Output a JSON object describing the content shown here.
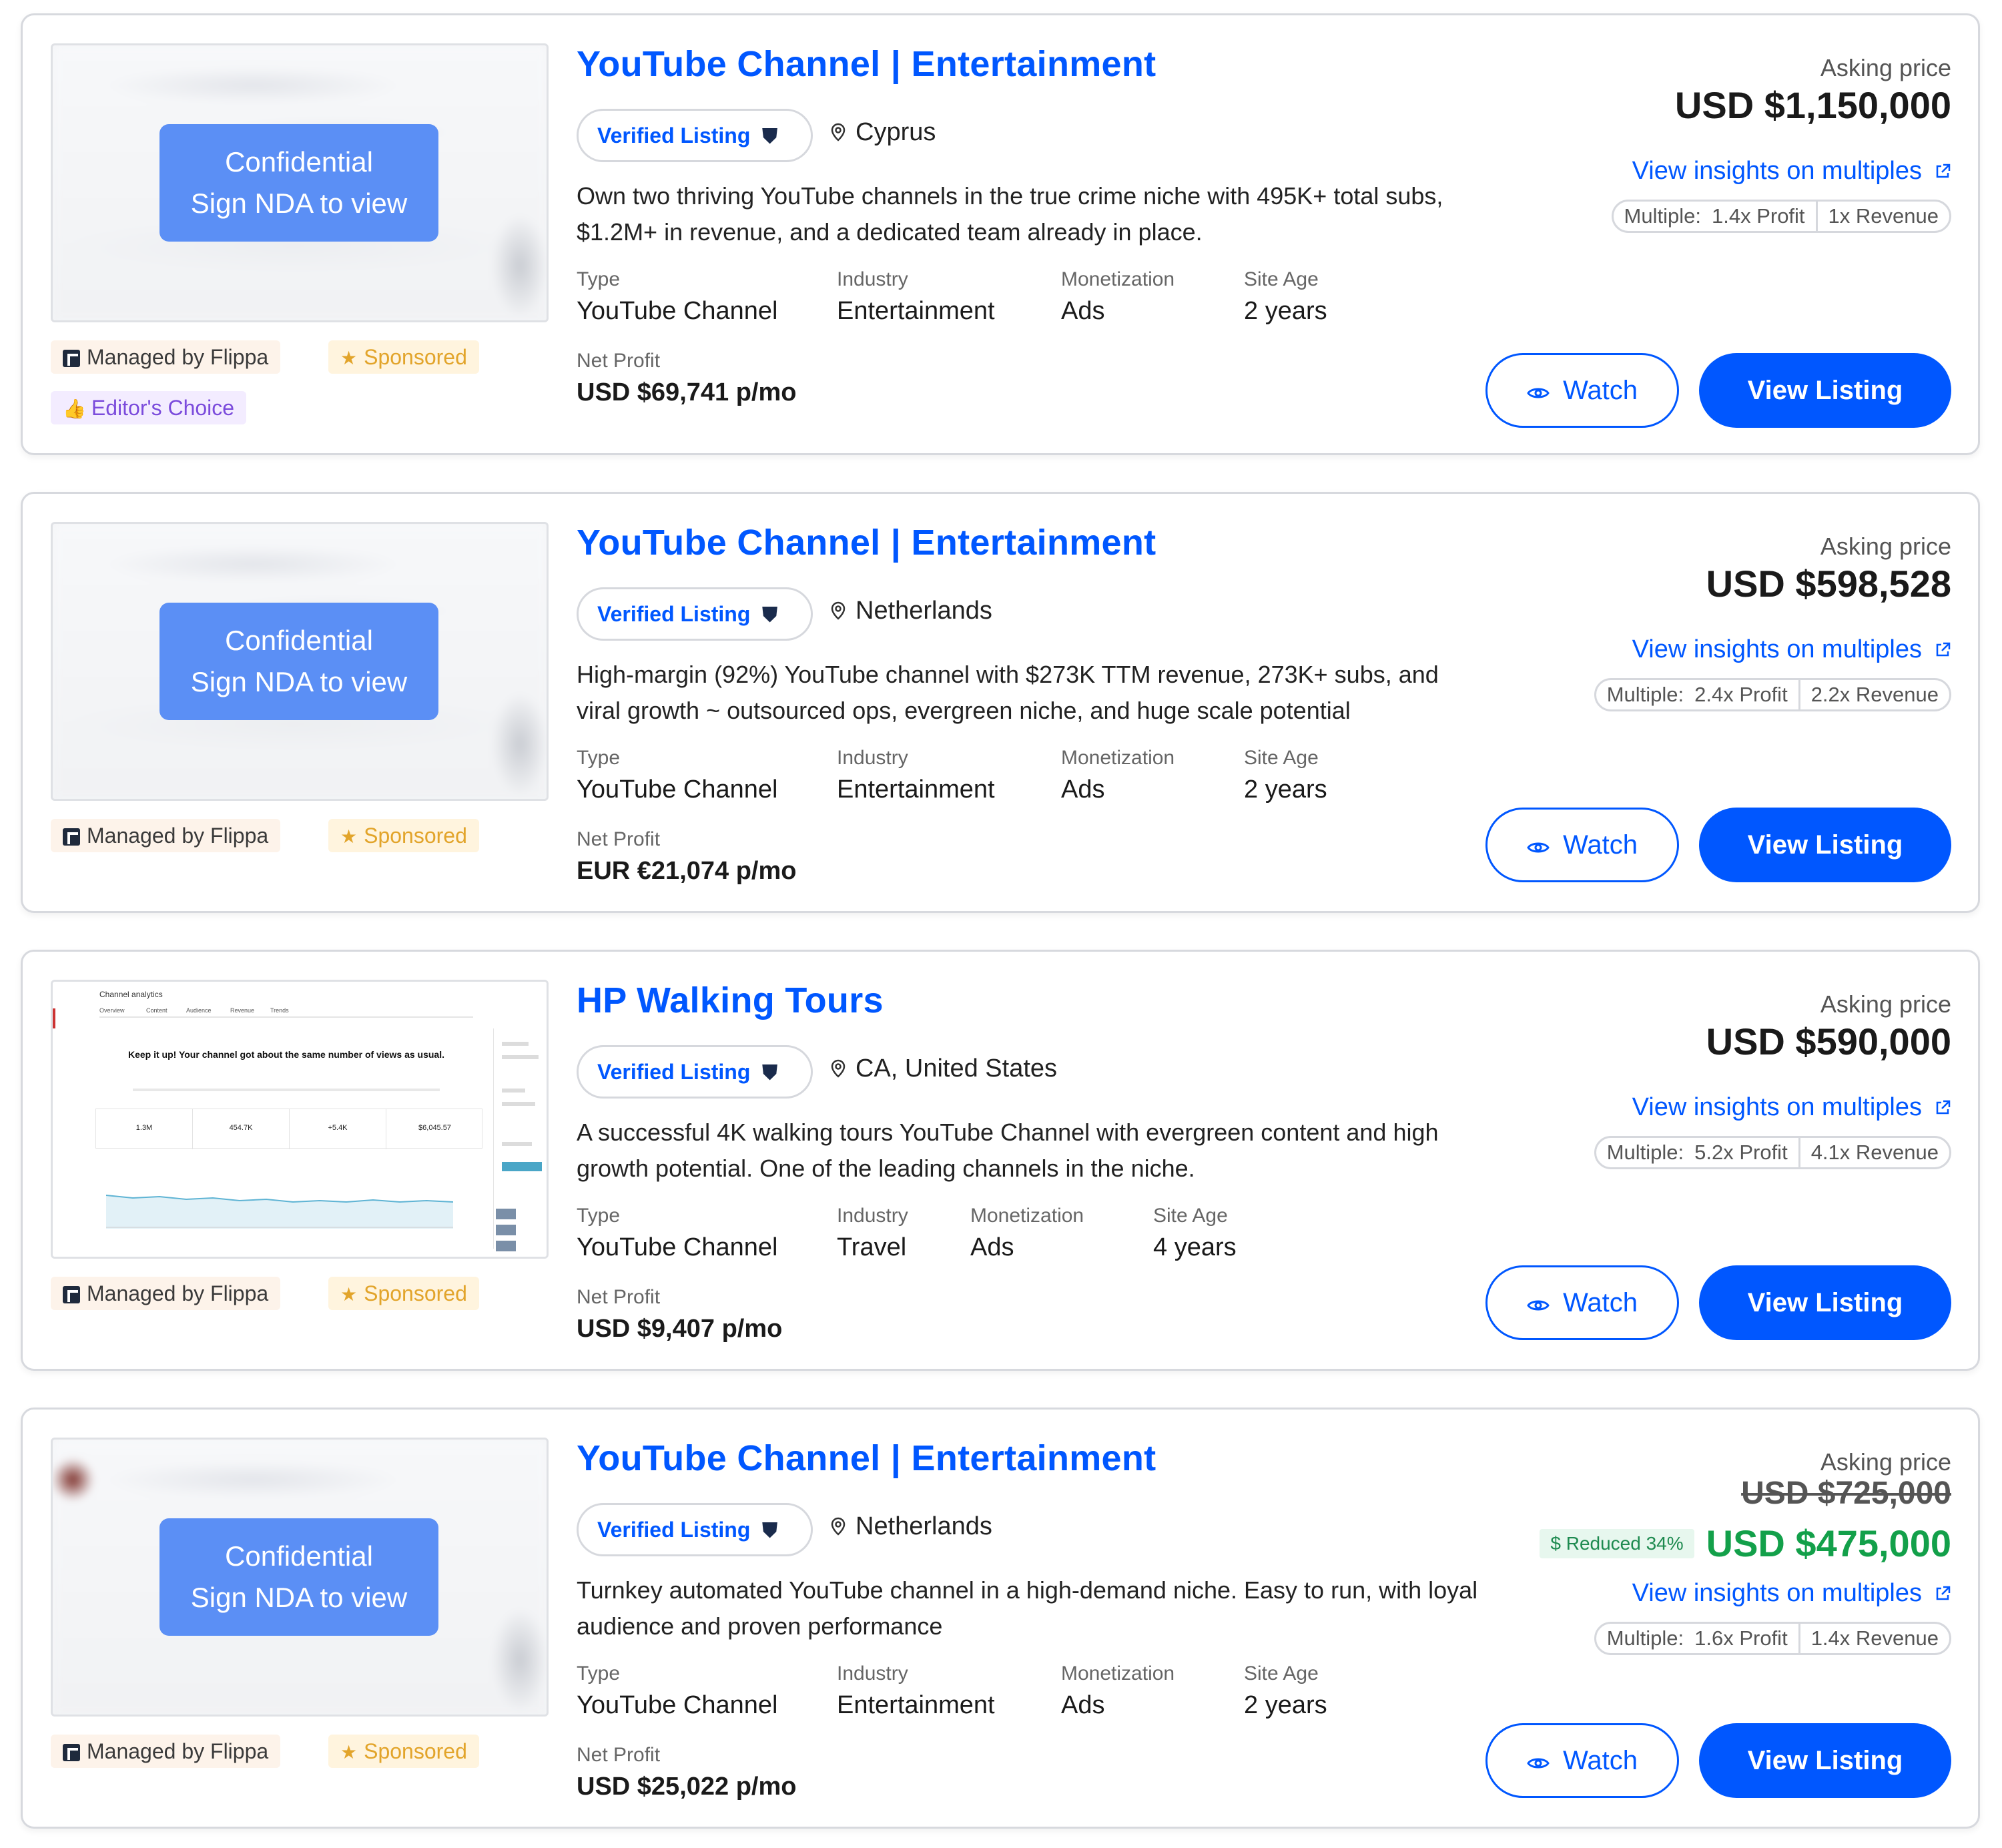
{
  "colors": {
    "brand_blue": "#0057ff",
    "nda_button": "#5b8ff5",
    "sponsored": "#e2a42a",
    "editors_choice": "#7b4bdc",
    "reduced_green": "#13a04a"
  },
  "labels": {
    "verified": "Verified Listing",
    "nda_line1": "Confidential",
    "nda_line2": "Sign NDA to view",
    "managed": "Managed by Flippa",
    "sponsored": "Sponsored",
    "editors_choice": "Editor's Choice",
    "type": "Type",
    "industry": "Industry",
    "monetization": "Monetization",
    "site_age": "Site Age",
    "net_profit": "Net Profit",
    "asking_price": "Asking price",
    "insights": "View insights on multiples",
    "multiple_prefix": "Multiple:",
    "watch": "Watch",
    "view_listing": "View Listing"
  },
  "listings": [
    {
      "title": "YouTube Channel | Entertainment",
      "location": "Cyprus",
      "description": "Own two thriving YouTube channels in the true crime niche with 495K+ total subs, $1.2M+ in revenue, and a dedicated team already in place.",
      "type": "YouTube Channel",
      "industry": "Entertainment",
      "monetization": "Ads",
      "site_age": "2 years",
      "net_profit": "USD $69,741 p/mo",
      "price": "USD $1,150,000",
      "multiple_profit": "1.4x Profit",
      "multiple_revenue": "1x Revenue"
    },
    {
      "title": "YouTube Channel | Entertainment",
      "location": "Netherlands",
      "description": "High-margin (92%) YouTube channel with $273K TTM revenue, 273K+ subs, and viral growth ~ outsourced ops, evergreen niche, and huge scale potential",
      "type": "YouTube Channel",
      "industry": "Entertainment",
      "monetization": "Ads",
      "site_age": "2 years",
      "net_profit": "EUR €21,074 p/mo",
      "price": "USD $598,528",
      "multiple_profit": "2.4x Profit",
      "multiple_revenue": "2.2x Revenue"
    },
    {
      "title": "HP Walking Tours",
      "location": "CA, United States",
      "description": "A successful 4K walking tours YouTube Channel with evergreen content and high growth potential. One of the leading channels in the niche.",
      "type": "YouTube Channel",
      "industry": "Travel",
      "monetization": "Ads",
      "site_age": "4 years",
      "net_profit": "USD $9,407 p/mo",
      "price": "USD $590,000",
      "multiple_profit": "5.2x Profit",
      "multiple_revenue": "4.1x Revenue",
      "thumbnail": {
        "title": "Channel analytics",
        "tabs": [
          "Overview",
          "Content",
          "Audience",
          "Revenue",
          "Trends"
        ],
        "headline": "Keep it up! Your channel got about the same number of views as usual.",
        "metrics": [
          "1.3M",
          "454.7K",
          "+5.4K",
          "$6,045.57"
        ]
      }
    },
    {
      "title": "YouTube Channel | Entertainment",
      "location": "Netherlands",
      "description": "Turnkey automated YouTube channel in a high-demand niche. Easy to run, with loyal audience and proven performance",
      "type": "YouTube Channel",
      "industry": "Entertainment",
      "monetization": "Ads",
      "site_age": "2 years",
      "net_profit": "USD $25,022 p/mo",
      "old_price": "USD $725,000",
      "reduced": "Reduced 34%",
      "price": "USD $475,000",
      "multiple_profit": "1.6x Profit",
      "multiple_revenue": "1.4x Revenue"
    }
  ]
}
